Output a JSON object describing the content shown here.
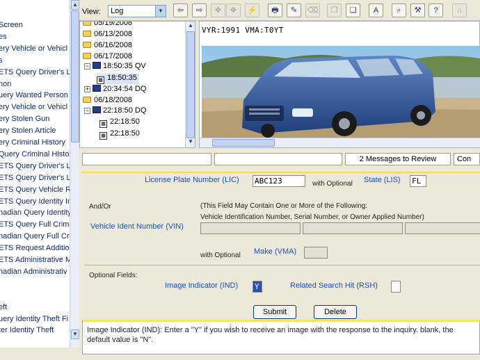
{
  "left_nav": {
    "items": [
      "Screen",
      "es",
      "ery Vehicle or Vehicl",
      "s",
      "ETS Query Driver's L",
      "non",
      "uery Wanted Person",
      "ery Vehicle or Vehicl",
      "ery Stolen Gun",
      "ery Stolen Article",
      "ery Criminal History",
      "Query Criminal Histo",
      "ETS Query Driver's L",
      "ETS Query Driver's Li",
      "ETS Query Vehicle R",
      "ETS Query Identity In",
      "nadian Query Identity",
      "ETS Query Full Crimi",
      "nadian Query Full Cri",
      "ETS Request Additio",
      "ETS Administrative M",
      "nadian Administrativ",
      "",
      "",
      "eft",
      "uery Identity Theft Fi",
      "ter Identity Theft"
    ]
  },
  "toolbar": {
    "view_label": "View:",
    "view_value": "Log",
    "buttons": [
      {
        "name": "back-icon",
        "glyph": "⇦",
        "enabled": true
      },
      {
        "name": "forward-icon",
        "glyph": "⇨",
        "enabled": true
      },
      {
        "name": "tool-3-icon",
        "glyph": "✥",
        "enabled": false
      },
      {
        "name": "tool-4-icon",
        "glyph": "✥",
        "enabled": false
      },
      {
        "name": "tool-5-icon",
        "glyph": "⚡",
        "enabled": false
      },
      {
        "name": "print-icon",
        "glyph": "🖶",
        "enabled": true
      },
      {
        "name": "edit-icon",
        "glyph": "✎",
        "enabled": true
      },
      {
        "name": "erase-icon",
        "glyph": "⌫",
        "enabled": false
      },
      {
        "name": "copy-icon",
        "glyph": "❐",
        "enabled": false
      },
      {
        "name": "paste-icon",
        "glyph": "❏",
        "enabled": true
      },
      {
        "name": "font-icon",
        "glyph": "A",
        "enabled": true
      },
      {
        "name": "find-icon",
        "glyph": "⌕",
        "enabled": true
      },
      {
        "name": "tools-icon",
        "glyph": "⚒",
        "enabled": true
      },
      {
        "name": "help-icon",
        "glyph": "?",
        "enabled": true
      },
      {
        "name": "home-icon",
        "glyph": "⌂",
        "enabled": false
      }
    ]
  },
  "tree": {
    "dates": [
      "05/19/2008",
      "06/13/2008",
      "06/16/2008",
      "06/17/2008",
      "06/18/2008"
    ],
    "entries": {
      "e1": "18:50:35 QV",
      "e1_child": "18:50:35",
      "e2": "20:34:54 DQ",
      "e3": "22:18:50 DQ",
      "e3_child1": "22:18:50",
      "e3_child2": "22:18:50"
    }
  },
  "vehicle_header": "VYR:1991 VMA:T0YT",
  "status": {
    "box1": "",
    "box2": "",
    "messages": "2 Messages to Review",
    "box4": "Con"
  },
  "form": {
    "lic_label": "License Plate Number (LIC)",
    "lic_value": "ABC123",
    "with_optional_1": "with Optional",
    "state_label": "State (LIS)",
    "state_value": "FL",
    "and_or": "And/Or",
    "vin_note_1": "(This Field May Contain One or More of the Following:",
    "vin_note_2": "Vehicle Identification Number, Serial Number, or Owner Applied Number)",
    "vin_label": "Vehicle Ident Number (VIN)",
    "with_optional_2": "with Optional",
    "vma_label": "Make (VMA)",
    "optional_fields": "Optional Fields:",
    "ind_label": "Image Indicator (IND)",
    "ind_value": "Y",
    "rsh_label": "Related Search Hit (RSH)",
    "submit_label": "Submit",
    "delete_label": "Delete"
  },
  "help_text": "Image Indicator (IND): Enter a \"Y\" if you wish to receive an image with the response to the inquiry. blank, the default value is \"N\"."
}
